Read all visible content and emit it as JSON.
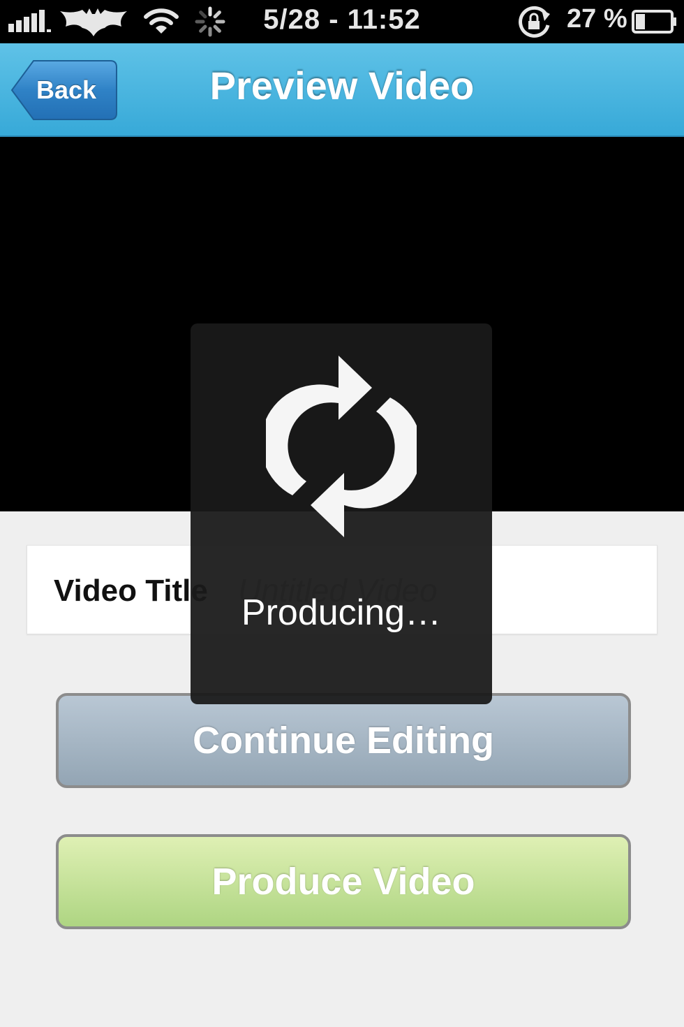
{
  "status_bar": {
    "time": "5/28 - 11:52",
    "battery_percent": "27 %",
    "icons": [
      "signal-icon",
      "carrier-logo-icon",
      "wifi-icon",
      "activity-spinner-icon",
      "rotation-lock-icon",
      "battery-icon"
    ],
    "battery_level": 0.27
  },
  "nav": {
    "back_label": "Back",
    "title": "Preview Video"
  },
  "form": {
    "video_title_label": "Video Title",
    "video_title_placeholder": "Untitled Video",
    "video_title_value": ""
  },
  "buttons": {
    "continue_editing": "Continue Editing",
    "produce_video": "Produce Video"
  },
  "overlay": {
    "icon": "refresh-icon",
    "label": "Producing…"
  },
  "colors": {
    "nav_bar": "#3fb1dd",
    "back_button": "#2d7fc0",
    "continue_button": "#a5b4c2",
    "produce_button": "#c3e39c",
    "overlay": "#1c1c1c"
  }
}
